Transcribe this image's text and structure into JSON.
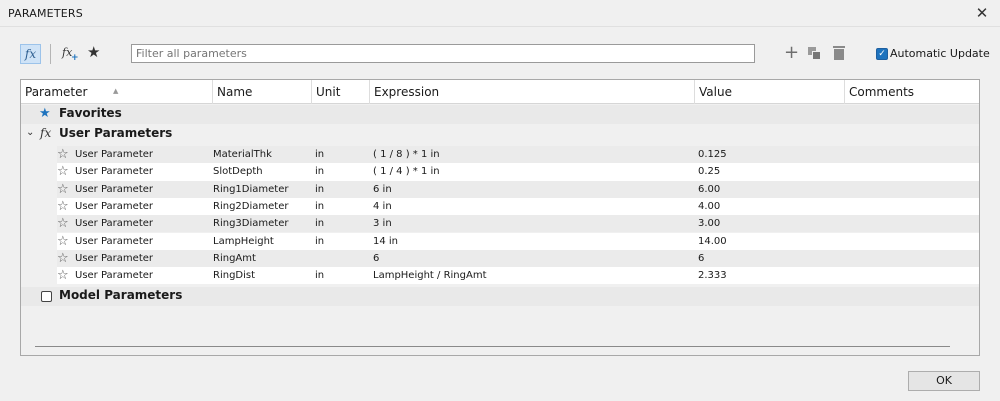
{
  "window": {
    "title": "PARAMETERS",
    "close_glyph": "✕"
  },
  "toolbar": {
    "fx_label": "fx",
    "add_user_param_label": "fx",
    "add_user_param_plus": "+",
    "favorites_glyph": "★",
    "search_placeholder": "Filter all parameters",
    "add_glyph": "+",
    "auto_update_checked": true,
    "auto_update_label": "Automatic Update",
    "check_glyph": "✓",
    "icons": [
      "fx-icon",
      "add-user-parameter-icon",
      "favorites-star-icon",
      "plus-icon",
      "copy-icon",
      "trash-icon"
    ]
  },
  "table": {
    "columns": [
      "Parameter",
      "Name",
      "Unit",
      "Expression",
      "Value",
      "Comments"
    ],
    "groups": {
      "favorites": {
        "label": "Favorites",
        "icon": "★"
      },
      "user": {
        "label": "User Parameters",
        "icon": "fx",
        "chevron": "⌄"
      },
      "model": {
        "label": "Model Parameters"
      }
    },
    "row_star_glyph": "☆",
    "rows": [
      {
        "parameter": "User Parameter",
        "name": "MaterialThk",
        "unit": "in",
        "expression": "( 1 / 8 ) * 1 in",
        "value": "0.125",
        "comments": ""
      },
      {
        "parameter": "User Parameter",
        "name": "SlotDepth",
        "unit": "in",
        "expression": "( 1 / 4 ) * 1 in",
        "value": "0.25",
        "comments": ""
      },
      {
        "parameter": "User Parameter",
        "name": "Ring1Diameter",
        "unit": "in",
        "expression": "6 in",
        "value": "6.00",
        "comments": ""
      },
      {
        "parameter": "User Parameter",
        "name": "Ring2Diameter",
        "unit": "in",
        "expression": "4 in",
        "value": "4.00",
        "comments": ""
      },
      {
        "parameter": "User Parameter",
        "name": "Ring3Diameter",
        "unit": "in",
        "expression": "3 in",
        "value": "3.00",
        "comments": ""
      },
      {
        "parameter": "User Parameter",
        "name": "LampHeight",
        "unit": "in",
        "expression": "14 in",
        "value": "14.00",
        "comments": ""
      },
      {
        "parameter": "User Parameter",
        "name": "RingAmt",
        "unit": "",
        "expression": "6",
        "value": "6",
        "comments": ""
      },
      {
        "parameter": "User Parameter",
        "name": "RingDist",
        "unit": "in",
        "expression": "LampHeight / RingAmt",
        "value": "2.333",
        "comments": ""
      }
    ]
  },
  "footer": {
    "ok_label": "OK"
  }
}
